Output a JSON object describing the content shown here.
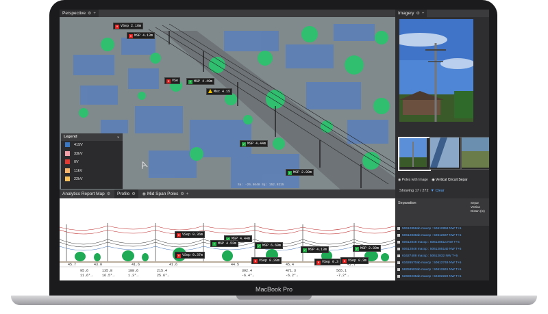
{
  "laptop": {
    "brand": "MacBook Pro"
  },
  "perspective": {
    "title": "Perspective"
  },
  "imagery": {
    "title": "Imagery"
  },
  "legend": {
    "title": "Legend",
    "items": [
      {
        "label": "415V",
        "color": "#3a78c4"
      },
      {
        "label": "33kV",
        "color": "#f4a0a8"
      },
      {
        "label": "0V",
        "color": "#e23a32"
      },
      {
        "label": "11kV",
        "color": "#f5b46a"
      },
      {
        "label": "22kV",
        "color": "#f7c35a"
      }
    ]
  },
  "scene_tags": [
    {
      "text": "VSep 2.16m",
      "status": "bad"
    },
    {
      "text": "MSP 4.13m",
      "status": "bad"
    },
    {
      "text": "VSe",
      "status": "bad"
    },
    {
      "text": "MSP 4.49m",
      "status": "ok"
    },
    {
      "text": "Msc 4.15",
      "status": "warn"
    },
    {
      "text": "MSP 4.44m",
      "status": "ok"
    },
    {
      "text": "MSP 2.90m",
      "status": "ok"
    }
  ],
  "scene_status": "Sa: -26.5648 Sq: 152.9215",
  "bottom_tabs": [
    {
      "label": "Analytics Report Map"
    },
    {
      "label": "Profile"
    },
    {
      "label": "Mid Span Poles"
    }
  ],
  "profile_tags": [
    {
      "text": "VSep 0.36m",
      "status": "bad"
    },
    {
      "text": "MSP 4.44m",
      "status": "ok"
    },
    {
      "text": "MSP 4.52m",
      "status": "ok"
    },
    {
      "text": "MSP 6.69m",
      "status": "ok"
    },
    {
      "text": "MSP 4.13m",
      "status": "ok"
    },
    {
      "text": "MSP 2.80m",
      "status": "ok"
    },
    {
      "text": "VSep 0.37m",
      "status": "bad"
    },
    {
      "text": "VSep 0.20m",
      "status": "bad"
    },
    {
      "text": "VSep 0.3",
      "status": "bad"
    },
    {
      "text": "VSep 0.3m",
      "status": "bad"
    }
  ],
  "profile_axis": {
    "top": [
      "45.7",
      "43.0",
      "41.6",
      "41.6",
      "44.5",
      "45.4",
      "42.7"
    ],
    "bottom": [
      "95.6",
      "135.8",
      "188.6",
      "215.4",
      "392.4",
      "471.3",
      "565.1"
    ],
    "angles": [
      "11.6°→",
      "16.5°→",
      "1.3°→",
      "25.6°→",
      "-6.4°→",
      "-6.2°→",
      "-7.2°→"
    ]
  },
  "imagery_tabs": [
    {
      "label": "Poles with Image"
    },
    {
      "label": "Vertical Circuit Separ"
    }
  ],
  "showing": {
    "text": "Showing 17 / 272",
    "clear": "Clear"
  },
  "table": {
    "col1": "Separation",
    "col2": "Separ Vertica Distan (m)",
    "rows": [
      "50612858ab maxcp : 50612858 NW T+5",
      "50612838ab maxcp : 50612847 NW T+5",
      "50612848 maxcp : 50612851a NW T+5",
      "50612848 maxcp : 50612851ab NW T+5",
      "61627408 maxcp : 50612832 NW T+5",
      "61626570ab maxcp : 50612749 NW T+5",
      "58258503ab maxcp : 50612841 NW T+5",
      "52690235ab maxcp : 50402222 NW T+5"
    ]
  }
}
